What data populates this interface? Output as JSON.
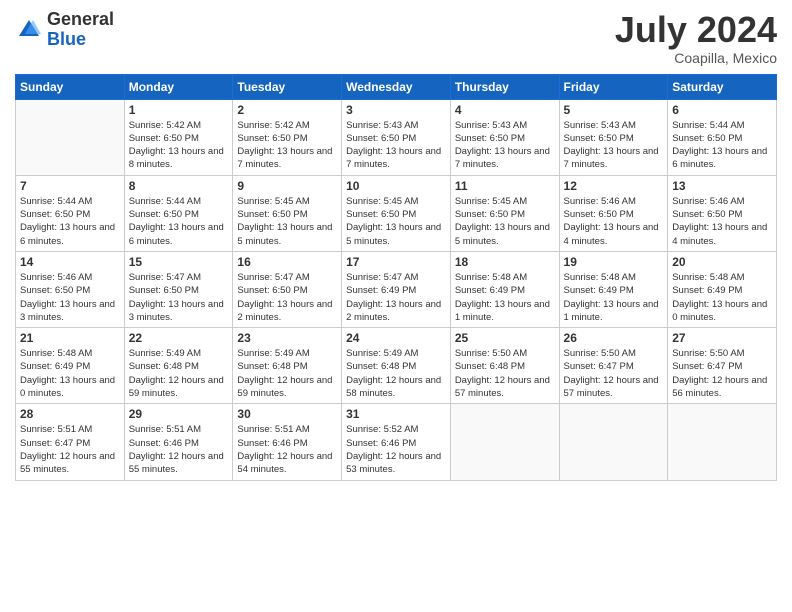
{
  "logo": {
    "general": "General",
    "blue": "Blue"
  },
  "header": {
    "month_year": "July 2024",
    "location": "Coapilla, Mexico"
  },
  "weekdays": [
    "Sunday",
    "Monday",
    "Tuesday",
    "Wednesday",
    "Thursday",
    "Friday",
    "Saturday"
  ],
  "weeks": [
    [
      {
        "day": "",
        "empty": true
      },
      {
        "day": "1",
        "sunrise": "5:42 AM",
        "sunset": "6:50 PM",
        "daylight": "13 hours and 8 minutes."
      },
      {
        "day": "2",
        "sunrise": "5:42 AM",
        "sunset": "6:50 PM",
        "daylight": "13 hours and 7 minutes."
      },
      {
        "day": "3",
        "sunrise": "5:43 AM",
        "sunset": "6:50 PM",
        "daylight": "13 hours and 7 minutes."
      },
      {
        "day": "4",
        "sunrise": "5:43 AM",
        "sunset": "6:50 PM",
        "daylight": "13 hours and 7 minutes."
      },
      {
        "day": "5",
        "sunrise": "5:43 AM",
        "sunset": "6:50 PM",
        "daylight": "13 hours and 7 minutes."
      },
      {
        "day": "6",
        "sunrise": "5:44 AM",
        "sunset": "6:50 PM",
        "daylight": "13 hours and 6 minutes."
      }
    ],
    [
      {
        "day": "7",
        "sunrise": "5:44 AM",
        "sunset": "6:50 PM",
        "daylight": "13 hours and 6 minutes."
      },
      {
        "day": "8",
        "sunrise": "5:44 AM",
        "sunset": "6:50 PM",
        "daylight": "13 hours and 6 minutes."
      },
      {
        "day": "9",
        "sunrise": "5:45 AM",
        "sunset": "6:50 PM",
        "daylight": "13 hours and 5 minutes."
      },
      {
        "day": "10",
        "sunrise": "5:45 AM",
        "sunset": "6:50 PM",
        "daylight": "13 hours and 5 minutes."
      },
      {
        "day": "11",
        "sunrise": "5:45 AM",
        "sunset": "6:50 PM",
        "daylight": "13 hours and 5 minutes."
      },
      {
        "day": "12",
        "sunrise": "5:46 AM",
        "sunset": "6:50 PM",
        "daylight": "13 hours and 4 minutes."
      },
      {
        "day": "13",
        "sunrise": "5:46 AM",
        "sunset": "6:50 PM",
        "daylight": "13 hours and 4 minutes."
      }
    ],
    [
      {
        "day": "14",
        "sunrise": "5:46 AM",
        "sunset": "6:50 PM",
        "daylight": "13 hours and 3 minutes."
      },
      {
        "day": "15",
        "sunrise": "5:47 AM",
        "sunset": "6:50 PM",
        "daylight": "13 hours and 3 minutes."
      },
      {
        "day": "16",
        "sunrise": "5:47 AM",
        "sunset": "6:50 PM",
        "daylight": "13 hours and 2 minutes."
      },
      {
        "day": "17",
        "sunrise": "5:47 AM",
        "sunset": "6:49 PM",
        "daylight": "13 hours and 2 minutes."
      },
      {
        "day": "18",
        "sunrise": "5:48 AM",
        "sunset": "6:49 PM",
        "daylight": "13 hours and 1 minute."
      },
      {
        "day": "19",
        "sunrise": "5:48 AM",
        "sunset": "6:49 PM",
        "daylight": "13 hours and 1 minute."
      },
      {
        "day": "20",
        "sunrise": "5:48 AM",
        "sunset": "6:49 PM",
        "daylight": "13 hours and 0 minutes."
      }
    ],
    [
      {
        "day": "21",
        "sunrise": "5:48 AM",
        "sunset": "6:49 PM",
        "daylight": "13 hours and 0 minutes."
      },
      {
        "day": "22",
        "sunrise": "5:49 AM",
        "sunset": "6:48 PM",
        "daylight": "12 hours and 59 minutes."
      },
      {
        "day": "23",
        "sunrise": "5:49 AM",
        "sunset": "6:48 PM",
        "daylight": "12 hours and 59 minutes."
      },
      {
        "day": "24",
        "sunrise": "5:49 AM",
        "sunset": "6:48 PM",
        "daylight": "12 hours and 58 minutes."
      },
      {
        "day": "25",
        "sunrise": "5:50 AM",
        "sunset": "6:48 PM",
        "daylight": "12 hours and 57 minutes."
      },
      {
        "day": "26",
        "sunrise": "5:50 AM",
        "sunset": "6:47 PM",
        "daylight": "12 hours and 57 minutes."
      },
      {
        "day": "27",
        "sunrise": "5:50 AM",
        "sunset": "6:47 PM",
        "daylight": "12 hours and 56 minutes."
      }
    ],
    [
      {
        "day": "28",
        "sunrise": "5:51 AM",
        "sunset": "6:47 PM",
        "daylight": "12 hours and 55 minutes."
      },
      {
        "day": "29",
        "sunrise": "5:51 AM",
        "sunset": "6:46 PM",
        "daylight": "12 hours and 55 minutes."
      },
      {
        "day": "30",
        "sunrise": "5:51 AM",
        "sunset": "6:46 PM",
        "daylight": "12 hours and 54 minutes."
      },
      {
        "day": "31",
        "sunrise": "5:52 AM",
        "sunset": "6:46 PM",
        "daylight": "12 hours and 53 minutes."
      },
      {
        "day": "",
        "empty": true
      },
      {
        "day": "",
        "empty": true
      },
      {
        "day": "",
        "empty": true
      }
    ]
  ],
  "labels": {
    "sunrise_prefix": "Sunrise: ",
    "sunset_prefix": "Sunset: ",
    "daylight_prefix": "Daylight: "
  }
}
